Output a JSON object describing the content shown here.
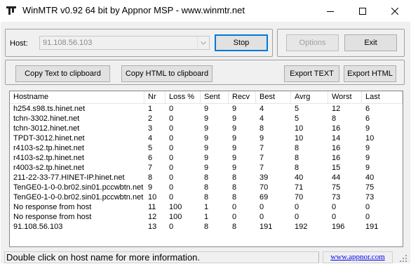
{
  "window": {
    "title": "WinMTR v0.92 64 bit by Appnor MSP - www.winmtr.net",
    "icon": "winmtr-app-icon",
    "controls": [
      "minimize-icon",
      "maximize-icon",
      "close-icon"
    ]
  },
  "host": {
    "label": "Host:",
    "value": "91.108.56.103"
  },
  "buttons": {
    "stop": "Stop",
    "options": "Options",
    "exit": "Exit",
    "copy_text": "Copy Text to clipboard",
    "copy_html": "Copy HTML to clipboard",
    "export_text": "Export TEXT",
    "export_html": "Export HTML"
  },
  "table": {
    "columns": [
      "Hostname",
      "Nr",
      "Loss %",
      "Sent",
      "Recv",
      "Best",
      "Avrg",
      "Worst",
      "Last"
    ],
    "rows": [
      [
        "h254.s98.ts.hinet.net",
        "1",
        "0",
        "9",
        "9",
        "4",
        "5",
        "12",
        "6"
      ],
      [
        "tchn-3302.hinet.net",
        "2",
        "0",
        "9",
        "9",
        "4",
        "5",
        "8",
        "6"
      ],
      [
        "tchn-3012.hinet.net",
        "3",
        "0",
        "9",
        "9",
        "8",
        "10",
        "16",
        "9"
      ],
      [
        "TPDT-3012.hinet.net",
        "4",
        "0",
        "9",
        "9",
        "9",
        "10",
        "14",
        "10"
      ],
      [
        "r4103-s2.tp.hinet.net",
        "5",
        "0",
        "9",
        "9",
        "7",
        "8",
        "16",
        "9"
      ],
      [
        "r4103-s2.tp.hinet.net",
        "6",
        "0",
        "9",
        "9",
        "7",
        "8",
        "16",
        "9"
      ],
      [
        "r4003-s2.tp.hinet.net",
        "7",
        "0",
        "9",
        "9",
        "7",
        "8",
        "15",
        "9"
      ],
      [
        "211-22-33-77.HINET-IP.hinet.net",
        "8",
        "0",
        "8",
        "8",
        "39",
        "40",
        "44",
        "40"
      ],
      [
        "TenGE0-1-0-0.br02.sin01.pccwbtn.net",
        "9",
        "0",
        "8",
        "8",
        "70",
        "71",
        "75",
        "75"
      ],
      [
        "TenGE0-1-0-0.br02.sin01.pccwbtn.net",
        "10",
        "0",
        "8",
        "8",
        "69",
        "70",
        "73",
        "73"
      ],
      [
        "No response from host",
        "11",
        "100",
        "1",
        "0",
        "0",
        "0",
        "0",
        "0"
      ],
      [
        "No response from host",
        "12",
        "100",
        "1",
        "0",
        "0",
        "0",
        "0",
        "0"
      ],
      [
        "91.108.56.103",
        "13",
        "0",
        "8",
        "8",
        "191",
        "192",
        "196",
        "191"
      ]
    ]
  },
  "status": {
    "text": "Double click on host name for more information.",
    "link": "www.appnor.com"
  }
}
